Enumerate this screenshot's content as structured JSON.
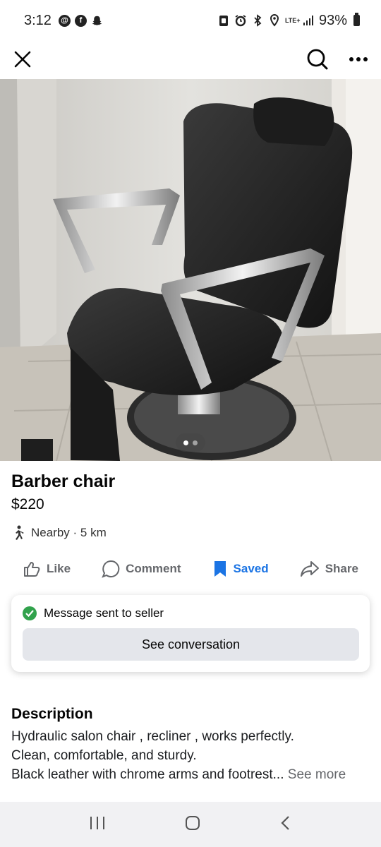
{
  "status_bar": {
    "time": "3:12",
    "network": "LTE+",
    "battery": "93%",
    "left_icons": [
      "threads-icon",
      "facebook-icon",
      "snapchat-icon"
    ],
    "right_icons": [
      "nfc-icon",
      "alarm-icon",
      "bluetooth-icon",
      "location-icon",
      "signal-icon",
      "battery-icon"
    ]
  },
  "listing": {
    "title": "Barber chair",
    "price": "$220",
    "location": "Nearby · 5 km",
    "photo_count": 2,
    "active_photo": 1
  },
  "actions": {
    "like": "Like",
    "comment": "Comment",
    "saved": "Saved",
    "share": "Share"
  },
  "message_card": {
    "status": "Message sent to seller",
    "button": "See conversation"
  },
  "description": {
    "heading": "Description",
    "line1": "Hydraulic salon chair , recliner , works perfectly.",
    "line2": "Clean, comfortable, and sturdy.",
    "line3": "Black leather with chrome arms and footrest...",
    "see_more": "See more"
  },
  "colors": {
    "accent": "#1b74e4",
    "success": "#31a24c",
    "button_bg": "#e4e6eb",
    "muted": "#65676b"
  }
}
